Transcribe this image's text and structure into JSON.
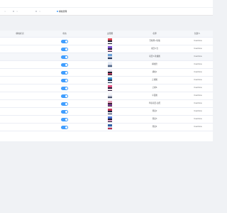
{
  "tabs": [
    {
      "label": "",
      "active": false
    },
    {
      "label": "",
      "active": false
    },
    {
      "label": "",
      "active": false
    },
    {
      "label": "横幅管理",
      "active": true
    }
  ],
  "table": {
    "columns": [
      "横幅标识",
      "状态",
      "主图图",
      "名称",
      "创建人"
    ],
    "rows": [
      {
        "name": "互联网+轮播",
        "creator": "Cusmine",
        "enabled": true,
        "thumb": {
          "bg": "#1e1e30",
          "a": "#d9434f",
          "b": "#e8e8f0"
        }
      },
      {
        "name": "项目公告",
        "creator": "Cusmine",
        "enabled": true,
        "thumb": {
          "bg": "#2a2240",
          "a": "#7b4fd0",
          "b": "#f0c0d0"
        }
      },
      {
        "name": "项目3-轮播图",
        "creator": "Cusmine",
        "enabled": true,
        "thumb": {
          "bg": "#d0d8e8",
          "a": "#6aa0d8",
          "b": "#2a3a5a"
        }
      },
      {
        "name": "横幅管",
        "creator": "Cusmine",
        "enabled": true,
        "thumb": {
          "bg": "#c8d0e0",
          "a": "#e8eef8",
          "b": "#4a6080"
        }
      },
      {
        "name": "横幅1",
        "creator": "Cusmine",
        "enabled": true,
        "thumb": {
          "bg": "#1c2030",
          "a": "#e8e0f0",
          "b": "#c04060"
        }
      },
      {
        "name": "正横图",
        "creator": "Cusmine",
        "enabled": true,
        "thumb": {
          "bg": "#203048",
          "a": "#3a8fd0",
          "b": "#d8e8f8"
        }
      },
      {
        "name": "正横6",
        "creator": "Cusmine",
        "enabled": true,
        "thumb": {
          "bg": "#2a1c38",
          "a": "#e05080",
          "b": "#f0e0e8"
        }
      },
      {
        "name": "平面图",
        "creator": "Cusmine",
        "enabled": true,
        "thumb": {
          "bg": "#d8dce8",
          "a": "#f4f4f8",
          "b": "#505870"
        }
      },
      {
        "name": "早稻项目-益阳",
        "creator": "Cusmine",
        "enabled": true,
        "thumb": {
          "bg": "#3a2030",
          "a": "#e0a0b8",
          "b": "#8040a0"
        }
      },
      {
        "name": "测试2",
        "creator": "Cusmine",
        "enabled": true,
        "thumb": {
          "bg": "#182040",
          "a": "#c83858",
          "b": "#e8e8f0"
        }
      },
      {
        "name": "测试3",
        "creator": "Cusmine",
        "enabled": true,
        "thumb": {
          "bg": "#201838",
          "a": "#5078d8",
          "b": "#d8a0c0"
        }
      },
      {
        "name": "测试4",
        "creator": "Cusmine",
        "enabled": true,
        "thumb": {
          "bg": "#d0d8e8",
          "a": "#3060a8",
          "b": "#b83050"
        }
      }
    ]
  },
  "colors": {
    "accent": "#409eff",
    "header_bg": "#f5f7fa",
    "highlight_row": "#f5f7fa"
  }
}
